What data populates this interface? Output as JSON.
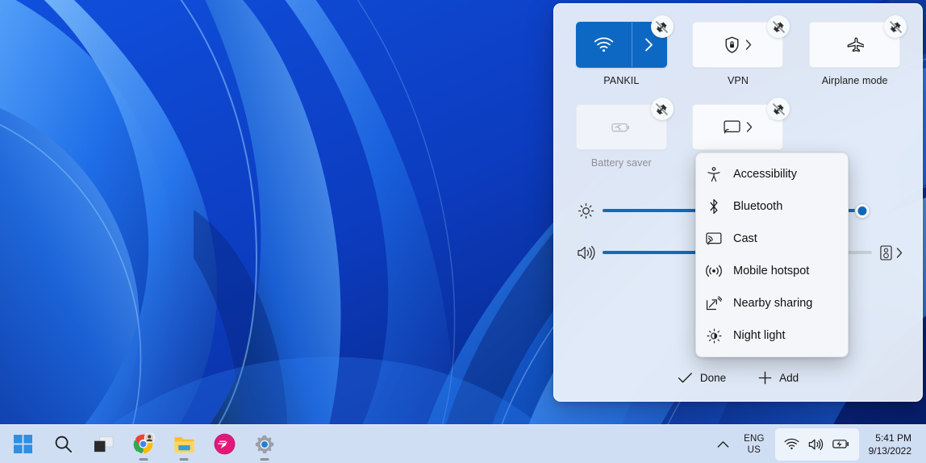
{
  "desktop": {
    "wallpaper_name": "windows-11-bloom-wallpaper",
    "colors": {
      "deep": "#0a36ab",
      "mid": "#1763e8",
      "light": "#57a8ff",
      "dark": "#061f6e"
    }
  },
  "quick_settings": {
    "tiles": [
      {
        "label": "PANKIL",
        "icon": "wifi-icon",
        "state": "on",
        "has_split_chevron": true,
        "has_inline_chevron": false,
        "pin_icon": "unpin-icon"
      },
      {
        "label": "VPN",
        "icon": "shield-lock-icon",
        "state": "off",
        "has_split_chevron": false,
        "has_inline_chevron": true,
        "pin_icon": "unpin-icon"
      },
      {
        "label": "Airplane mode",
        "icon": "airplane-icon",
        "state": "off",
        "has_split_chevron": false,
        "has_inline_chevron": false,
        "pin_icon": "unpin-icon"
      },
      {
        "label": "Battery saver",
        "icon": "battery-saver-icon",
        "state": "disabled",
        "has_split_chevron": false,
        "has_inline_chevron": false,
        "pin_icon": "unpin-icon"
      },
      {
        "label": "",
        "icon": "cast-icon",
        "state": "off",
        "has_split_chevron": false,
        "has_inline_chevron": true,
        "pin_icon": "unpin-icon"
      }
    ],
    "sliders": [
      {
        "name": "brightness",
        "icon": "brightness-icon",
        "value": 97
      },
      {
        "name": "volume",
        "icon": "volume-icon",
        "value": 72,
        "tail_icon": "audio-output-icon",
        "tail_chevron": "chevron-right-icon"
      }
    ],
    "footer": {
      "done_label": "Done",
      "done_icon": "checkmark-icon",
      "add_label": "Add",
      "add_icon": "plus-icon"
    }
  },
  "context_menu": {
    "items": [
      {
        "label": "Accessibility",
        "icon": "accessibility-icon"
      },
      {
        "label": "Bluetooth",
        "icon": "bluetooth-icon"
      },
      {
        "label": "Cast",
        "icon": "cast-icon"
      },
      {
        "label": "Mobile hotspot",
        "icon": "mobile-hotspot-icon"
      },
      {
        "label": "Nearby sharing",
        "icon": "nearby-sharing-icon"
      },
      {
        "label": "Night light",
        "icon": "night-light-icon"
      }
    ]
  },
  "taskbar": {
    "apps": [
      {
        "name": "start-button",
        "icon": "windows-logo-icon",
        "running": false
      },
      {
        "name": "search-button",
        "icon": "search-icon",
        "running": false
      },
      {
        "name": "task-view-button",
        "icon": "task-view-icon",
        "running": false
      },
      {
        "name": "chrome-button",
        "icon": "chrome-icon",
        "running": true
      },
      {
        "name": "file-explorer-button",
        "icon": "folder-icon",
        "running": true
      },
      {
        "name": "app-pink-button",
        "icon": "pink-app-icon",
        "running": false
      },
      {
        "name": "settings-button",
        "icon": "settings-gear-icon",
        "running": true
      }
    ],
    "tray": {
      "chevron_icon": "chevron-up-icon",
      "language_line1": "ENG",
      "language_line2": "US",
      "icons": [
        "wifi-icon",
        "volume-icon",
        "battery-charging-icon"
      ],
      "time": "5:41 PM",
      "date": "9/13/2022"
    }
  }
}
